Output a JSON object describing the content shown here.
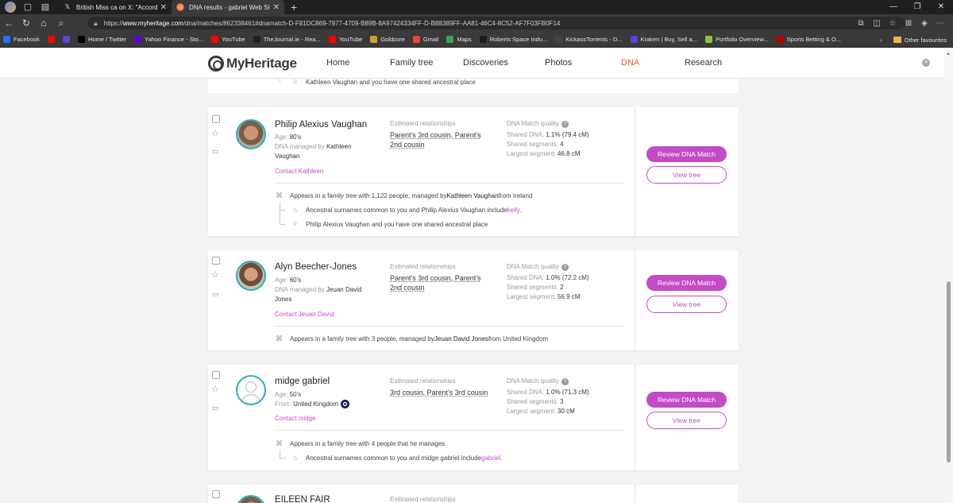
{
  "browser": {
    "tabs": [
      {
        "title": "British Miss ca on X: \"According",
        "icon": "x-logo-icon",
        "active": false
      },
      {
        "title": "DNA results - gabriel Web Site -",
        "icon": "myheritage-favicon",
        "active": true
      }
    ],
    "url_prefix": "https://",
    "url_domain": "www.myheritage.com",
    "url_path": "/dna/matches/862338461#dnamatch-D-F81DC869-7977-4709-B89B-8A97424334FF-D-B88389FF-AA81-46C4-8C52-AF7F03FB0F14",
    "bookmarks": [
      {
        "label": "Facebook",
        "color": "#1877f2"
      },
      {
        "label": "",
        "color": "#ff0000"
      },
      {
        "label": "",
        "color": "#5a43d6"
      },
      {
        "label": "Home / Twitter",
        "color": "#000000"
      },
      {
        "label": "Yahoo Finance - Sto...",
        "color": "#6001d2"
      },
      {
        "label": "YouTube",
        "color": "#ff0000"
      },
      {
        "label": "TheJournal.ie - Rea...",
        "color": "#222222"
      },
      {
        "label": "YouTube",
        "color": "#ff0000"
      },
      {
        "label": "Goldcore",
        "color": "#c9a227"
      },
      {
        "label": "Gmail",
        "color": "#ea4335"
      },
      {
        "label": "Maps",
        "color": "#34a853"
      },
      {
        "label": "Roberts Space Indu...",
        "color": "#1b1b1b"
      },
      {
        "label": "KickassTorrents - D...",
        "color": "#444444"
      },
      {
        "label": "Kraken | Buy, Sell a...",
        "color": "#5741d9"
      },
      {
        "label": "Portfolio Overview...",
        "color": "#8dc63f"
      },
      {
        "label": "Sports Betting & O...",
        "color": "#b30000"
      }
    ],
    "other_favourites": "Other favourites"
  },
  "site": {
    "logo": "MyHeritage",
    "nav": [
      "Home",
      "Family tree",
      "Discoveries",
      "Photos",
      "DNA",
      "Research"
    ],
    "active_nav": "DNA",
    "accent": "#c44bc6",
    "nav_active_color": "#e85d2a"
  },
  "top_stub": {
    "text": "Kathleen Vaughan and you have one shared ancestral place"
  },
  "labels": {
    "est_rel": "Estimated relationships",
    "quality": "DNA Match quality",
    "shared_dna": "Shared DNA:",
    "shared_segments": "Shared segments:",
    "largest_segment": "Largest segment:",
    "review": "Review DNA Match",
    "view_tree": "View tree",
    "age": "Age:",
    "managed_by": "DNA managed by",
    "from": "From:"
  },
  "matches": [
    {
      "name": "Philip Alexius Vaughan",
      "age": "80's",
      "managed_by": "Kathleen Vaughan",
      "contact": "Contact Kathleen",
      "relationship": "Parent's 3rd cousin, Parent's 2nd cousin",
      "shared_dna": "1.1% (79.4 cM)",
      "shared_segments": "4",
      "largest_segment": "46.8 cM",
      "tree_pre": "Appears in a family tree with 1,122 people, managed by ",
      "tree_owner": "Kathleen Vaughan",
      "tree_post": " from Ireland",
      "surnames_pre": "Ancestral surnames common to you and Philip Alexius Vaughan include ",
      "surnames_link": "kelly",
      "surnames_post": ".",
      "place": "Philip Alexius Vaughan and you have one shared ancestral place"
    },
    {
      "name": "Alyn Beecher-Jones",
      "age": "60's",
      "managed_by": "Jeuan David Jones",
      "contact": "Contact Jeuan David",
      "relationship": "Parent's 3rd cousin, Parent's 2nd cousin",
      "shared_dna": "1.0% (72.2 cM)",
      "shared_segments": "2",
      "largest_segment": "56.9 cM",
      "tree_pre": "Appears in a family tree with 3 people, managed by ",
      "tree_owner": "Jeuan David Jones",
      "tree_post": " from United Kingdom"
    },
    {
      "name": "midge gabriel",
      "age": "50's",
      "from": "United Kingdom",
      "contact": "Contact midge",
      "relationship": "3rd cousin, Parent's 3rd cousin",
      "shared_dna": "1.0% (71.3 cM)",
      "shared_segments": "3",
      "largest_segment": "30 cM",
      "tree_text": "Appears in a family tree with 4 people that he manages",
      "surnames_pre": "Ancestral surnames common to you and midge gabriel include ",
      "surnames_link": "gabriel",
      "surnames_post": "."
    },
    {
      "name": "EILEEN FAIR",
      "relationship_header": "Estimated relationships"
    }
  ]
}
